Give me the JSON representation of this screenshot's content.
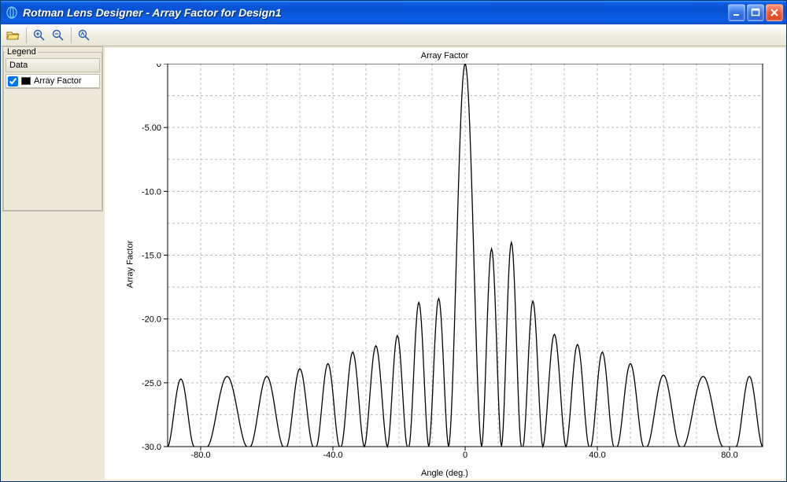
{
  "window": {
    "title": "Rotman Lens Designer - Array Factor for Design1"
  },
  "toolbar": {
    "open_tooltip": "Open",
    "zoom_in_tooltip": "Zoom In",
    "zoom_out_tooltip": "Zoom Out",
    "zoom_fit_tooltip": "Zoom Fit"
  },
  "legend": {
    "group_label": "Legend",
    "header": "Data",
    "items": [
      {
        "checked": true,
        "swatch": "#000000",
        "label": "Array Factor"
      }
    ]
  },
  "chart_data": {
    "type": "line",
    "title": "Array Factor",
    "xlabel": "Angle (deg.)",
    "ylabel": "Array Factor",
    "xlim": [
      -90,
      90
    ],
    "ylim": [
      -30,
      0
    ],
    "xticks": [
      -80,
      -40,
      0,
      40,
      80
    ],
    "yticks": [
      0,
      -5,
      -10,
      -15,
      -20,
      -25,
      -30
    ],
    "xtick_labels": [
      "-80.0",
      "-40.0",
      "0",
      "40.0",
      "80.0"
    ],
    "ytick_labels": [
      "0",
      "-5.00",
      "-10.0",
      "-15.0",
      "-20.0",
      "-25.0",
      "-30.0"
    ],
    "minor_xticks": [
      -90,
      -80,
      -70,
      -60,
      -50,
      -40,
      -30,
      -20,
      -10,
      0,
      10,
      20,
      30,
      40,
      50,
      60,
      70,
      80,
      90
    ],
    "minor_yticks": [
      0,
      -2.5,
      -5,
      -7.5,
      -10,
      -12.5,
      -15,
      -17.5,
      -20,
      -22.5,
      -25,
      -27.5,
      -30
    ],
    "series": [
      {
        "name": "Array Factor",
        "color": "#000000",
        "peak_angles": [
          -86,
          -72,
          -60,
          -50,
          -41.5,
          -34,
          -27,
          -20.5,
          -14,
          -8,
          0,
          8,
          14,
          20.5,
          27,
          34,
          41.5,
          50,
          60,
          72,
          86
        ],
        "peak_values": [
          -24.7,
          -24.5,
          -24.5,
          -23.9,
          -23.5,
          -22.6,
          -22.1,
          -21.3,
          -18.7,
          -18.4,
          0,
          -14.5,
          -14.0,
          -18.6,
          -21.2,
          -22.0,
          -22.6,
          -23.5,
          -24.4,
          -24.5,
          -24.5
        ],
        "null_angles": [
          -80,
          -66,
          -55,
          -46,
          -38,
          -30.5,
          -23.5,
          -17,
          -11,
          -5,
          5,
          11,
          17,
          23.5,
          30.5,
          38,
          46,
          55,
          66,
          80
        ]
      }
    ]
  },
  "colors": {
    "titlebar_gradient_top": "#3a95ff",
    "titlebar_gradient_bottom": "#0a4fc8",
    "close_btn": "#d8401b",
    "panel_bg": "#ece9d8"
  }
}
